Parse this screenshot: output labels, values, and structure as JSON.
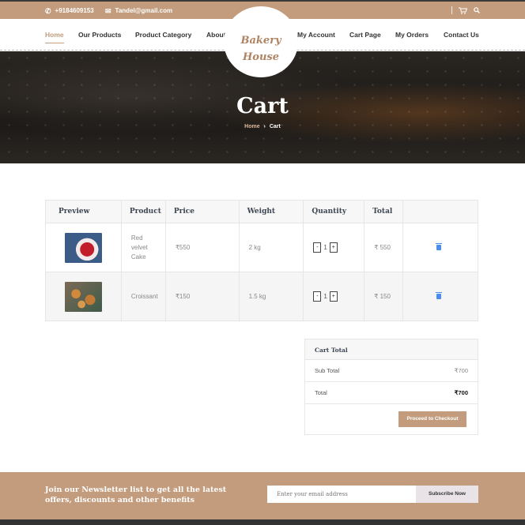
{
  "topbar": {
    "phone": "+9184609153",
    "email": "Tandel@gmail.com",
    "icons": [
      "phone-icon",
      "mail-icon",
      "cart-icon",
      "search-icon"
    ]
  },
  "nav": {
    "items": [
      "Home",
      "Our Products",
      "Product Category",
      "About Us",
      "My Account",
      "Cart Page",
      "My Orders",
      "Contact Us"
    ],
    "active": "Home"
  },
  "logo": {
    "line1": "Bakery",
    "line2": "House"
  },
  "hero": {
    "title": "Cart",
    "breadcrumb_home": "Home",
    "breadcrumb_sep": "›",
    "breadcrumb_current": "Cart"
  },
  "cart_table": {
    "headers": [
      "Preview",
      "Product",
      "Price",
      "Weight",
      "Quantity",
      "Total",
      ""
    ],
    "rows": [
      {
        "product": "Red velvet Cake",
        "price": "₹550",
        "weight": "2 kg",
        "minus": "-",
        "qty": "1",
        "plus": "+",
        "total": "₹ 550"
      },
      {
        "product": "Croissant",
        "price": "₹150",
        "weight": "1.5 kg",
        "minus": "-",
        "qty": "1",
        "plus": "+",
        "total": "₹ 150"
      }
    ]
  },
  "cart_total": {
    "title": "Cart Total",
    "subtotal_label": "Sub Total",
    "subtotal_value": "₹700",
    "total_label": "Total",
    "total_value": "₹700",
    "checkout_label": "Proceed to Checkout"
  },
  "newsletter": {
    "text": "Join our Newsletter list to get all the latest offers, discounts and other benefits",
    "placeholder": "Enter your email address",
    "button": "Subscribe Now"
  },
  "colors": {
    "accent": "#c29c7c",
    "dark": "#333333"
  }
}
